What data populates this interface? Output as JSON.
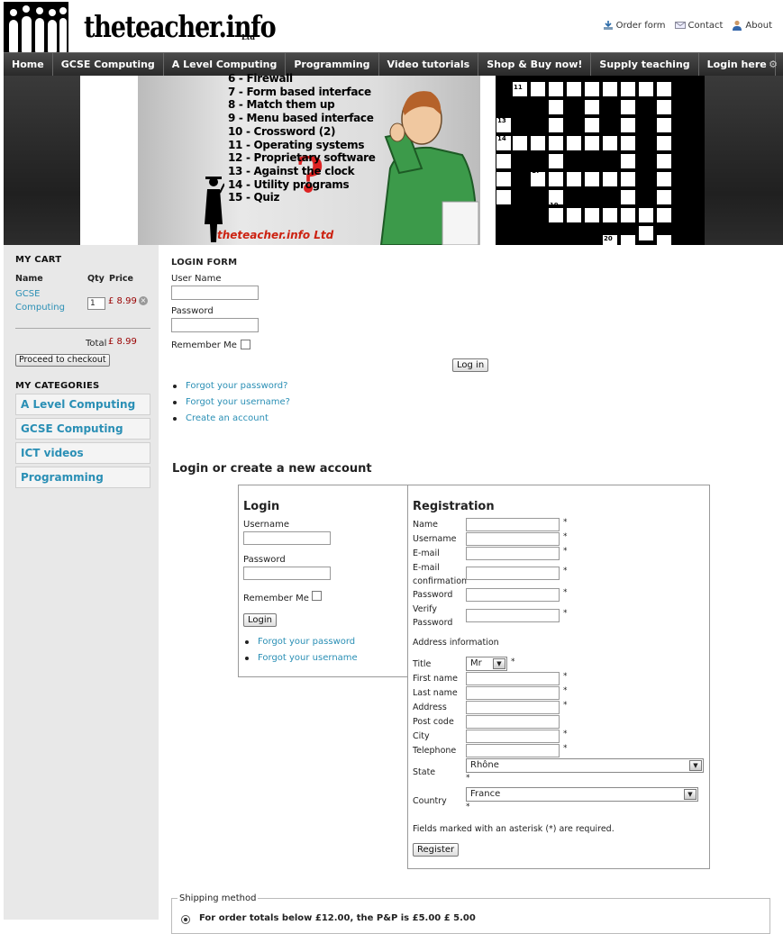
{
  "header": {
    "logo_text": "theteacher.info",
    "logo_suffix": "Ltd",
    "links": [
      {
        "label": "Order form",
        "icon": "download-icon"
      },
      {
        "label": "Contact",
        "icon": "mail-icon"
      },
      {
        "label": "About",
        "icon": "user-icon"
      }
    ]
  },
  "nav": {
    "items": [
      "Home",
      "GCSE Computing",
      "A Level Computing",
      "Programming",
      "Video tutorials",
      "Shop & Buy now!",
      "Supply teaching",
      "Login here"
    ],
    "gear_icon": "gear-icon"
  },
  "banner": {
    "list": [
      "6 - Firewall",
      "7 - Form based interface",
      "8 - Match them up",
      "9 - Menu based interface",
      "10 - Crossword (2)",
      "11 - Operating systems",
      "12 - Proprietary software",
      "13 - Against the clock",
      "14 - Utility programs",
      "15 - Quiz"
    ],
    "caption": "theteacher.info Ltd",
    "crossword_numbers": [
      "11",
      "13",
      "14",
      "17",
      "19",
      "20"
    ]
  },
  "cart": {
    "title": "MY CART",
    "col_name": "Name",
    "col_qty": "Qty",
    "col_price": "Price",
    "item_name": "GCSE Computing",
    "item_qty": "1",
    "item_price": "£ 8.99",
    "total_label": "Total",
    "total_value": "£ 8.99",
    "checkout": "Proceed to checkout"
  },
  "categories": {
    "title": "MY CATEGORIES",
    "items": [
      "A Level Computing",
      "GCSE Computing",
      "ICT videos",
      "Programming"
    ]
  },
  "login_form": {
    "title": "LOGIN FORM",
    "user_label": "User Name",
    "pass_label": "Password",
    "remember": "Remember Me",
    "submit": "Log in",
    "links": [
      "Forgot your password?",
      "Forgot your username?",
      "Create an account"
    ]
  },
  "account": {
    "title": "Login or create a new account",
    "login": {
      "title": "Login",
      "user_label": "Username",
      "pass_label": "Password",
      "remember": "Remember Me",
      "submit": "Login",
      "links": [
        "Forgot your password",
        "Forgot your username"
      ]
    },
    "registration": {
      "title": "Registration",
      "fields": [
        {
          "label": "Name",
          "req": "*"
        },
        {
          "label": "Username",
          "req": "*"
        },
        {
          "label": "E-mail",
          "req": "*"
        },
        {
          "label": "E-mail confirmation",
          "req": "*"
        },
        {
          "label": "Password",
          "req": "*"
        },
        {
          "label": "Verify Password",
          "req": "*"
        }
      ],
      "address_title": "Address information",
      "title_label": "Title",
      "title_value": "Mr",
      "title_req": "*",
      "addr_fields": [
        {
          "label": "First name",
          "req": "*"
        },
        {
          "label": "Last name",
          "req": "*"
        },
        {
          "label": "Address",
          "req": "*"
        },
        {
          "label": "Post code",
          "req": ""
        },
        {
          "label": "City",
          "req": "*"
        },
        {
          "label": "Telephone",
          "req": "*"
        }
      ],
      "state_label": "State",
      "state_value": "Rhône",
      "state_req": "*",
      "country_label": "Country",
      "country_value": "France",
      "country_req": "*",
      "note": "Fields marked with an asterisk (*) are required.",
      "submit": "Register"
    }
  },
  "shipping": {
    "legend": "Shipping method",
    "option": "For order totals below £12.00, the P&P is £5.00 £ 5.00"
  }
}
